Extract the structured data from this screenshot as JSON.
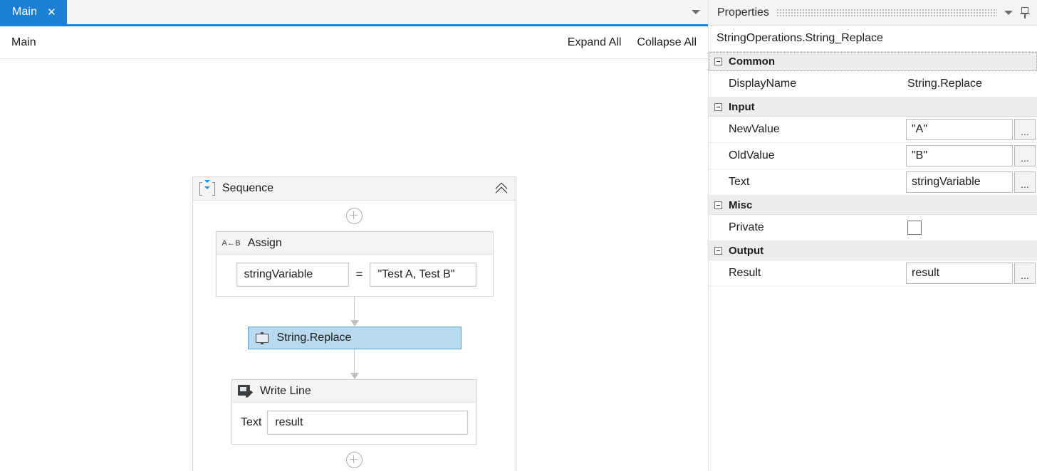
{
  "designer": {
    "tab": {
      "label": "Main",
      "close_icon": "close-icon",
      "dropdown_icon": "chevron-down-icon"
    },
    "breadcrumb": {
      "path": "Main",
      "expand_all": "Expand All",
      "collapse_all": "Collapse All"
    },
    "workflow": {
      "sequence": {
        "title": "Sequence",
        "icon": "sequence-icon",
        "collapse_icon": "chevron-double-up-icon",
        "add_icon": "plus-circle-icon"
      },
      "assign": {
        "title": "Assign",
        "icon": "assign-icon",
        "icon_glyph": "A←B",
        "left_value": "stringVariable",
        "operator": "=",
        "right_value": "\"Test A, Test B\""
      },
      "string_replace": {
        "title": "String.Replace",
        "icon": "activity-screen-icon",
        "selected": true
      },
      "write_line": {
        "title": "Write Line",
        "icon": "write-line-icon",
        "text_label": "Text",
        "text_value": "result"
      }
    }
  },
  "properties": {
    "panel_title": "Properties",
    "caret_icon": "chevron-down-icon",
    "pin_icon": "pin-icon",
    "object_name": "StringOperations.String_Replace",
    "groups": [
      {
        "label": "Common",
        "rows": [
          {
            "name": "DisplayName",
            "value": "String.Replace",
            "kind": "text"
          }
        ]
      },
      {
        "label": "Input",
        "rows": [
          {
            "name": "NewValue",
            "value": "\"A\"",
            "kind": "input",
            "ellipsis": "..."
          },
          {
            "name": "OldValue",
            "value": "\"B\"",
            "kind": "input",
            "ellipsis": "..."
          },
          {
            "name": "Text",
            "value": "stringVariable",
            "kind": "input",
            "ellipsis": "..."
          }
        ]
      },
      {
        "label": "Misc",
        "rows": [
          {
            "name": "Private",
            "value": "",
            "kind": "checkbox",
            "checked": false
          }
        ]
      },
      {
        "label": "Output",
        "rows": [
          {
            "name": "Result",
            "value": "result",
            "kind": "input",
            "ellipsis": "..."
          }
        ]
      }
    ]
  },
  "colors": {
    "tab_active": "#1b7fd4",
    "selection_fill": "#b9d9ef",
    "selection_border": "#5ba4d6",
    "sequence_arrow": "#2a8fe0",
    "group_header_bg": "#ededed"
  }
}
